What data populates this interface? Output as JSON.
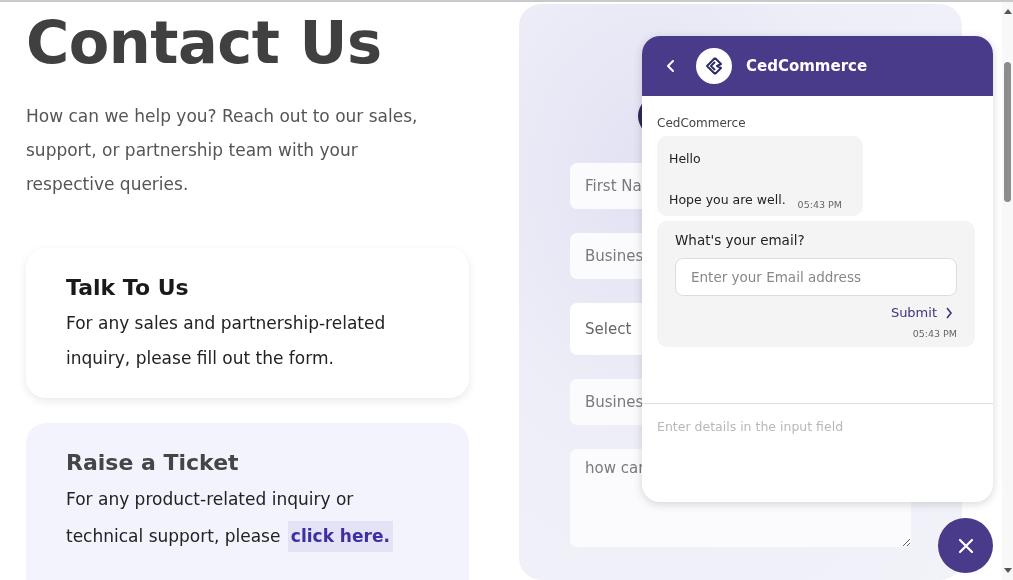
{
  "page": {
    "title": "Contact Us",
    "intro": "How can we help you? Reach out to our sales, support, or partnership team with your respective queries."
  },
  "cards": [
    {
      "kind": "plain",
      "title": "Talk To Us",
      "text": "For any sales and partnership-related inquiry, please fill out the form."
    },
    {
      "kind": "tinted",
      "title": "Raise a Ticket",
      "text": "For any product-related inquiry or technical support, please",
      "link": "click here."
    }
  ],
  "form": {
    "fields": [
      {
        "kind": "input",
        "placeholder": "First Na"
      },
      {
        "kind": "input",
        "placeholder": "Busines"
      },
      {
        "kind": "select",
        "placeholder": "Select"
      },
      {
        "kind": "input",
        "placeholder": "Busines"
      },
      {
        "kind": "textarea",
        "placeholder": "how car"
      }
    ]
  },
  "chat": {
    "title": "CedCommerce",
    "sender": "CedCommerce",
    "messages": [
      {
        "kind": "text",
        "lines": [
          "Hello",
          "Hope you are well."
        ],
        "time": "05:43 PM"
      },
      {
        "kind": "email_prompt",
        "question": "What's your email?",
        "placeholder": "Enter your Email address",
        "button": "Submit",
        "time": "05:43 PM"
      }
    ],
    "input_placeholder": "Enter details in the input field"
  }
}
